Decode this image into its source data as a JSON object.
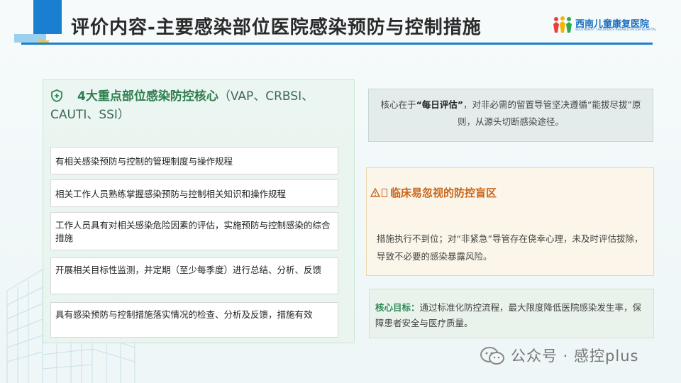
{
  "header": {
    "title": "评价内容-主要感染部位医院感染预防与控制措施",
    "logo_name": "西南儿童康复医院",
    "logo_subtitle": "SOUTHWEST CHILDREN'S REHABILITATION HOSPITAL",
    "accent_color": "#1a7fd0"
  },
  "left_panel": {
    "icon": "shield-icon",
    "header_core": "4大重点部位感染防控核心",
    "header_paren": "（VAP、CRBSI、CAUTI、SSI）",
    "items": [
      "有相关感染预防与控制的管理制度与操作规程",
      "相关工作人员熟练掌握感染预防与控制相关知识和操作规程",
      "工作人员具有对相关感染危险因素的评估，实施预防与控制感染的综合措施",
      "开展相关目标性监测，并定期（至少每季度）进行总结、分析、反馈",
      "具有感染预防与控制措施落实情况的检查、分析及反馈，措施有效"
    ]
  },
  "core_box": {
    "prefix": "核心在于",
    "highlight": "“每日评估”",
    "suffix": "，对非必需的留置导管坚决遵循“能拔尽拔”原则，从源头切断感染途径。"
  },
  "warning_box": {
    "icon": "warning-icon",
    "title": "临床易忽视的防控盲区",
    "body": "措施执行不到位；对“非紧急”导管存在侥幸心理，未及时评估拔除，导致不必要的感染暴露风险。",
    "title_color": "#c8651b"
  },
  "goal_box": {
    "label": "核心目标：",
    "text": "通过标准化防控流程，最大限度降低医院感染发生率，保障患者安全与医疗质量。",
    "label_color": "#2e8b57"
  },
  "watermark": {
    "icon": "wechat-icon",
    "text": "公众号 · 感控plus"
  }
}
